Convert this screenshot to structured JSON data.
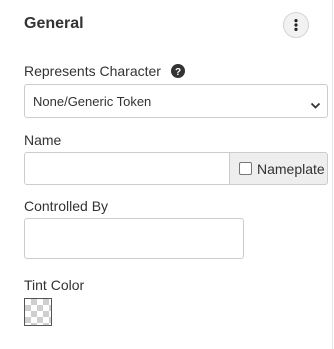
{
  "header": {
    "title": "General",
    "more_icon": "vertical-ellipsis-icon"
  },
  "represents": {
    "label": "Represents Character",
    "help_icon": "question-circle-icon",
    "selected": "None/Generic Token",
    "chevron_icon": "chevron-down-icon"
  },
  "name": {
    "label": "Name",
    "value": "",
    "nameplate_label": "Nameplate",
    "nameplate_checked": false
  },
  "controlled_by": {
    "label": "Controlled By",
    "value": ""
  },
  "tint": {
    "label": "Tint Color",
    "value": "transparent"
  }
}
